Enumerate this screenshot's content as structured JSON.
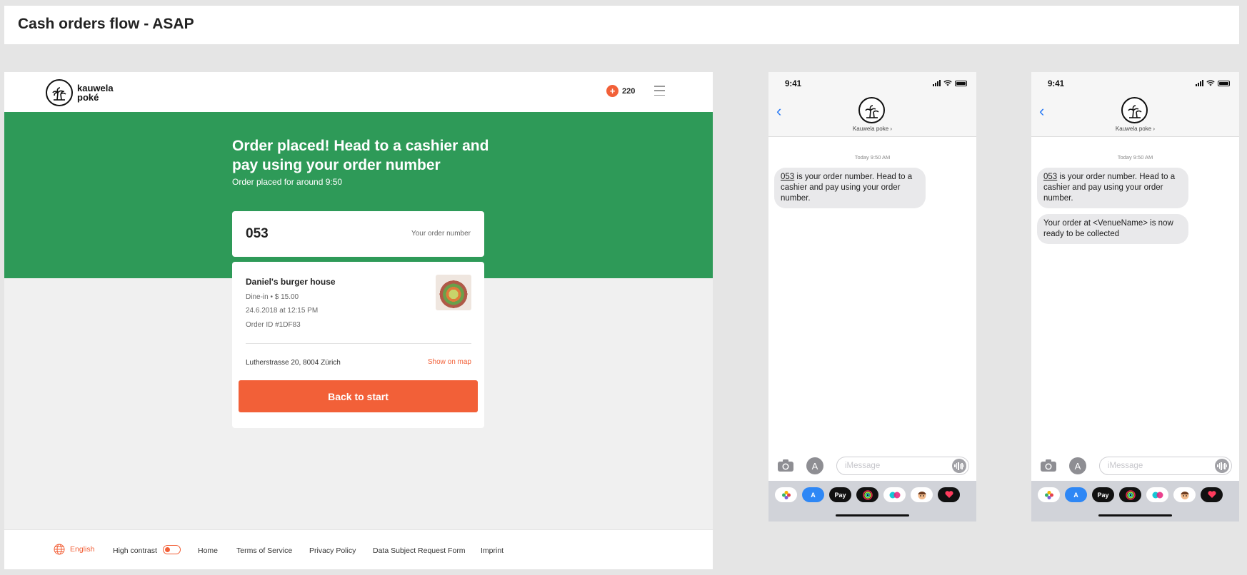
{
  "page": {
    "title": "Cash orders flow - ASAP"
  },
  "web": {
    "brand": {
      "line1": "kauwela",
      "line2": "poké"
    },
    "points": "220",
    "hero": {
      "title": "Order placed! Head to a cashier and pay using your order number",
      "subtitle": "Order placed for around 9:50"
    },
    "order": {
      "number": "053",
      "number_label": "Your order number",
      "venue": "Daniel's burger house",
      "type_price": "Dine-in • $ 15.00",
      "datetime": "24.6.2018 at 12:15 PM",
      "order_id": "Order ID #1DF83",
      "address": "Lutherstrasse 20, 8004 Zürich",
      "map_link": "Show on map",
      "back_button": "Back to start"
    },
    "footer": {
      "language": "English",
      "high_contrast": "High contrast",
      "links": [
        "Home",
        "Terms of Service",
        "Privacy Policy",
        "Data Subject Request Form",
        "Imprint"
      ]
    },
    "colors": {
      "accent": "#f26038",
      "hero": "#2e9a58"
    }
  },
  "phones": [
    {
      "time": "9:41",
      "contact": "Kauwela poke ›",
      "date": "Today 9:50 AM",
      "messages": [
        {
          "num": "053",
          "text": " is your order number. Head to a cashier and pay using your order number."
        }
      ],
      "input_placeholder": "iMessage"
    },
    {
      "time": "9:41",
      "contact": "Kauwela poke ›",
      "date": "Today 9:50 AM",
      "messages": [
        {
          "num": "053",
          "text": " is your order number. Head to a cashier and pay using your order number."
        },
        {
          "num": "",
          "text": "Your order at <VenueName> is now ready to be collected"
        }
      ],
      "input_placeholder": "iMessage"
    }
  ],
  "tray_icons": [
    "photos-icon",
    "appstore-icon",
    "applepay-icon",
    "activity-icon",
    "digital-touch-icon",
    "memoji-icon",
    "heart-sticker-icon"
  ],
  "tray_labels": {
    "applepay": "Pay"
  }
}
